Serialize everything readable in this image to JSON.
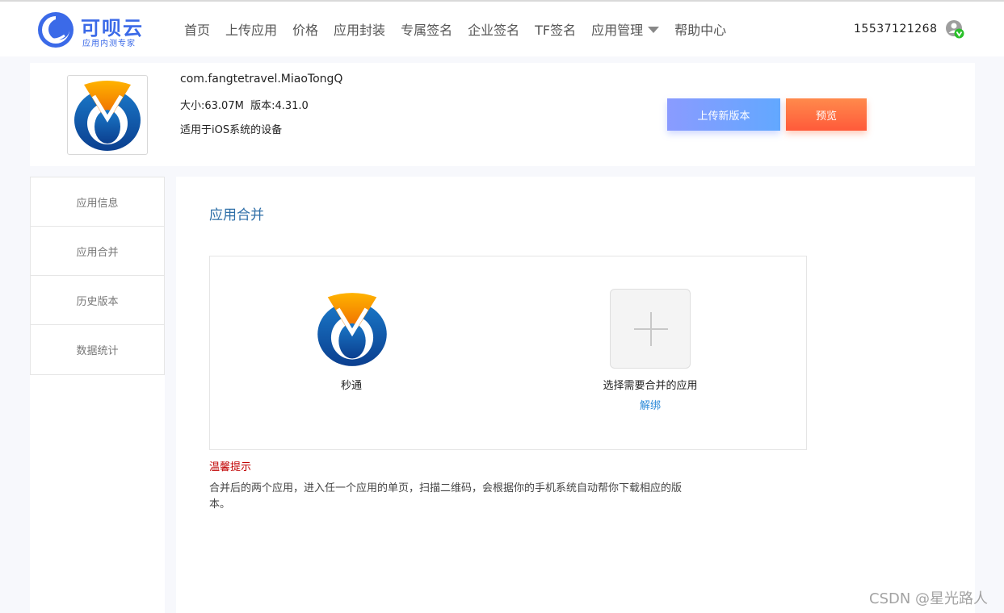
{
  "header": {
    "logo_name": "可呗云",
    "logo_slogan": "应用内测专家",
    "nav": [
      {
        "label": "首页"
      },
      {
        "label": "上传应用"
      },
      {
        "label": "价格"
      },
      {
        "label": "应用封装"
      },
      {
        "label": "专属签名"
      },
      {
        "label": "企业签名"
      },
      {
        "label": "TF签名"
      },
      {
        "label": "应用管理"
      },
      {
        "label": "帮助中心"
      }
    ],
    "phone": "15537121268",
    "avatar_icon": "user-verified-icon"
  },
  "app": {
    "bundle_id": "com.fangtetravel.MiaoTongQ",
    "meta": "大小:63.07M  版本:4.31.0",
    "device": "适用于iOS系统的设备",
    "upload_button": "上传新版本",
    "preview_button": "预览"
  },
  "sidebar": {
    "items": [
      {
        "label": "应用信息"
      },
      {
        "label": "应用合并"
      },
      {
        "label": "历史版本"
      },
      {
        "label": "数据统计"
      }
    ]
  },
  "main": {
    "title": "应用合并",
    "app_name": "秒通",
    "select_label": "选择需要合并的应用",
    "unbind_label": "解绑",
    "tip_title": "温馨提示",
    "tip_text": "合并后的两个应用，进入任一个应用的单页，扫描二维码，会根据你的手机系统自动帮你下载相应的版本。"
  },
  "watermark": "CSDN @星光路人",
  "colors": {
    "brand": "#3b6ae8",
    "title_blue": "#2f6fa8",
    "link": "#2b8ad8",
    "warning": "#c00000",
    "upload_gradient_start": "#8a9bff",
    "preview_gradient_start": "#ff8a4c"
  }
}
